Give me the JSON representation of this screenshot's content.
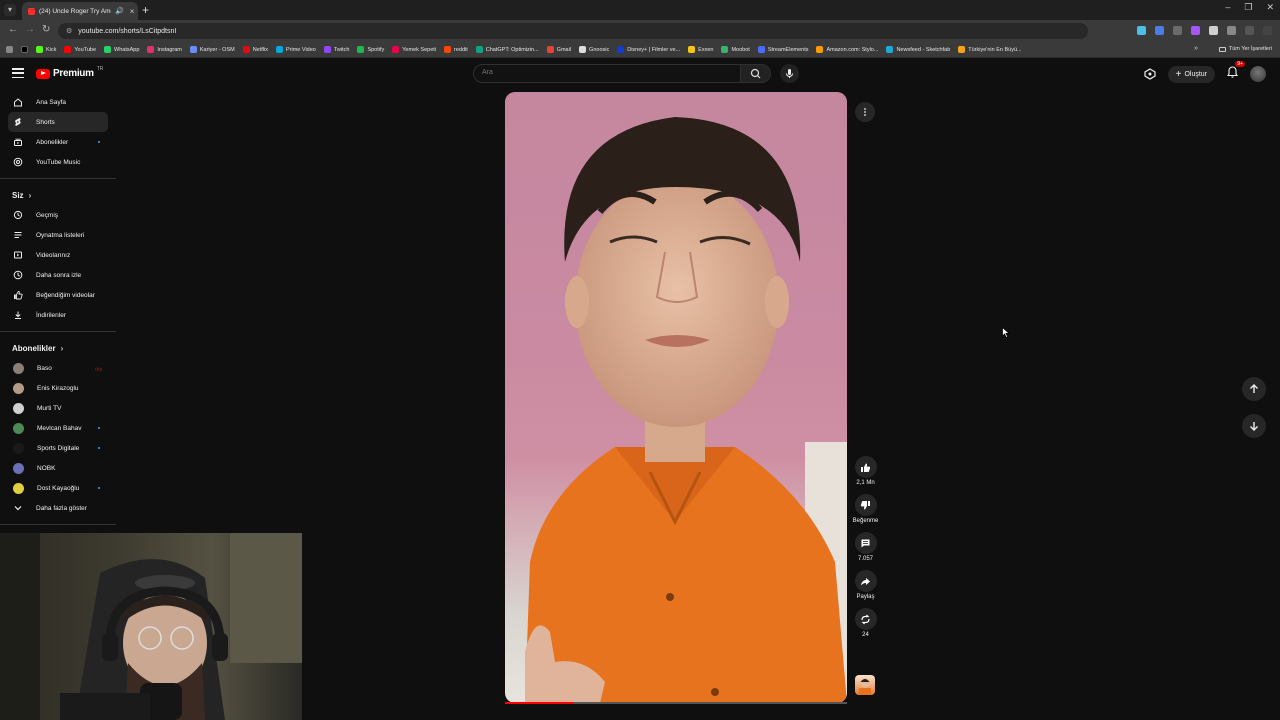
{
  "browser": {
    "tab_title": "(24) Uncle Roger Try Ameri",
    "url": "youtube.com/shorts/LsCitpdtsnI",
    "bookmarks": [
      {
        "label": "Kick",
        "color": "#53fc18"
      },
      {
        "label": "YouTube",
        "color": "#ff0000"
      },
      {
        "label": "WhatsApp",
        "color": "#25d366"
      },
      {
        "label": "Instagram",
        "color": "#e1306c"
      },
      {
        "label": "Kariyer - OSM",
        "color": "#6b8cff"
      },
      {
        "label": "Netflix",
        "color": "#e50914"
      },
      {
        "label": "Prime Video",
        "color": "#00a8e1"
      },
      {
        "label": "Twitch",
        "color": "#9146ff"
      },
      {
        "label": "Spotify",
        "color": "#1db954"
      },
      {
        "label": "Yemek Sepeti",
        "color": "#ea004b"
      },
      {
        "label": "reddit",
        "color": "#ff4500"
      },
      {
        "label": "ChatGPT: Optimizin...",
        "color": "#10a37f"
      },
      {
        "label": "Gmail",
        "color": "#ea4335"
      },
      {
        "label": "Gnoosic",
        "color": "#dddddd"
      },
      {
        "label": "Disney+ | Filmler ve...",
        "color": "#113ccf"
      },
      {
        "label": "Exxen",
        "color": "#f5c518"
      },
      {
        "label": "Moobot",
        "color": "#37b36b"
      },
      {
        "label": "StreamElements",
        "color": "#4d6bff"
      },
      {
        "label": "Amazon.com: Stylo...",
        "color": "#ff9900"
      },
      {
        "label": "Newsfeed - Sketchfab",
        "color": "#1caad9"
      },
      {
        "label": "Türkiye'nin En Büyü...",
        "color": "#f7a21b"
      }
    ],
    "all_bookmarks_label": "Tüm Yer İşaretleri"
  },
  "header": {
    "logo_text": "Premium",
    "logo_country": "TR",
    "search_placeholder": "Ara",
    "create_label": "Oluştur",
    "notification_badge": "9+"
  },
  "sidebar": {
    "main": [
      {
        "label": "Ana Sayfa",
        "icon": "home-icon"
      },
      {
        "label": "Shorts",
        "icon": "shorts-icon",
        "active": true
      },
      {
        "label": "Abonelikler",
        "icon": "subscriptions-icon",
        "dot": true
      },
      {
        "label": "YouTube Music",
        "icon": "music-icon"
      }
    ],
    "you_title": "Siz",
    "you": [
      {
        "label": "Geçmiş",
        "icon": "history-icon"
      },
      {
        "label": "Oynatma listeleri",
        "icon": "playlists-icon"
      },
      {
        "label": "Videolarınız",
        "icon": "your-videos-icon"
      },
      {
        "label": "Daha sonra izle",
        "icon": "watch-later-icon"
      },
      {
        "label": "Beğendiğim videolar",
        "icon": "liked-videos-icon"
      },
      {
        "label": "İndirilenler",
        "icon": "downloads-icon"
      }
    ],
    "subs_title": "Abonelikler",
    "subs": [
      {
        "label": "Baso",
        "live": true,
        "color": "#8a7f78"
      },
      {
        "label": "Enis Kirazoglu",
        "color": "#b59b86"
      },
      {
        "label": "Murti TV",
        "color": "#d0d0d0"
      },
      {
        "label": "Mevlcan Bahav",
        "dot": true,
        "color": "#4b8a55"
      },
      {
        "label": "Sports Digitale",
        "dot": true,
        "color": "#1a1a1a"
      },
      {
        "label": "NOBK",
        "color": "#6b6fb5"
      },
      {
        "label": "Dost Kayaoğlu",
        "dot": true,
        "color": "#e0d040"
      }
    ],
    "show_more": "Daha fazla göster"
  },
  "short": {
    "progress": 0.2,
    "actions": {
      "likes": "2,1 Mn",
      "dislike": "Beğenme",
      "comments": "7.057",
      "share": "Paylaş",
      "remix": "24"
    }
  }
}
